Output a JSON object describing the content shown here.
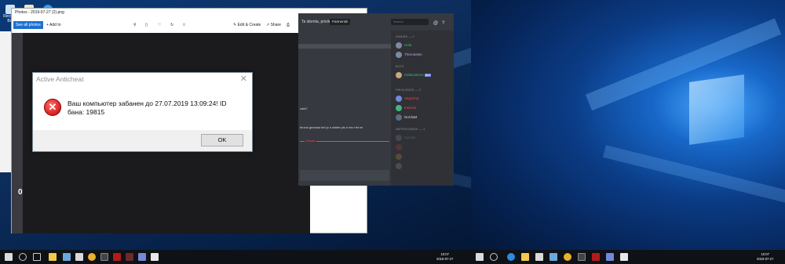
{
  "desktop": {
    "icons": [
      {
        "label": "Recycle Bin",
        "icon": "recycle-bin-icon"
      },
      {
        "label": "",
        "icon": "file-icon"
      },
      {
        "label": "",
        "icon": "app-icon"
      }
    ]
  },
  "photos": {
    "title": "Photos - 2019-07-27 (2).png",
    "see_all": "See all photos",
    "add_to": "Add to",
    "edit_create": "Edit & Create",
    "share": "Share",
    "tab_marker": "0"
  },
  "discord": {
    "header_text": "Ta idomta, privileg(s)/",
    "channel_pill": "Partnerski",
    "search_placeholder": "Search",
    "chat_lines": [
      "zaid?",
      "bruciu geuciau bei jo o daber pis ir cnc het ce"
    ],
    "chat_marker": "Ekstra",
    "categories": [
      {
        "title": "ADMINS — 2",
        "members": [
          {
            "name": "Hola",
            "color": "#43b581"
          },
          {
            "name": "ThisHasMe",
            "color": "#b59fe3"
          }
        ]
      },
      {
        "title": "BOTS",
        "members": [
          {
            "name": "Kaltausterss",
            "color": "#43b581",
            "badge": "BOT"
          }
        ]
      },
      {
        "title": "PRIVILEGED — 3",
        "members": [
          {
            "name": "Aegorma",
            "color": "#f04747"
          },
          {
            "name": "Internia",
            "color": "#f04747"
          },
          {
            "name": "NoClaM",
            "color": "#dcddde"
          }
        ]
      },
      {
        "title": "NEPRISIJUNGE — 3",
        "members": [
          {
            "name": "Cyrean",
            "color": "#5e8a66"
          },
          {
            "name": "",
            "color": "#8a3a3a"
          },
          {
            "name": "",
            "color": "#8a6a3a"
          },
          {
            "name": "",
            "color": "#6e6e6e"
          }
        ]
      }
    ]
  },
  "dialog": {
    "title": "Active Anticheat",
    "close": "✕",
    "error_glyph": "✕",
    "message": "Ваш компьютер забанен до 27.07.2019 13:09:24! ID бана: 19815",
    "ok_label": "OK"
  },
  "taskbar_left": {
    "clock_time": "10:07",
    "clock_date": "2019-07-27"
  },
  "taskbar_right": {
    "clock_time": "10:07",
    "clock_date": "2019-07-27"
  }
}
